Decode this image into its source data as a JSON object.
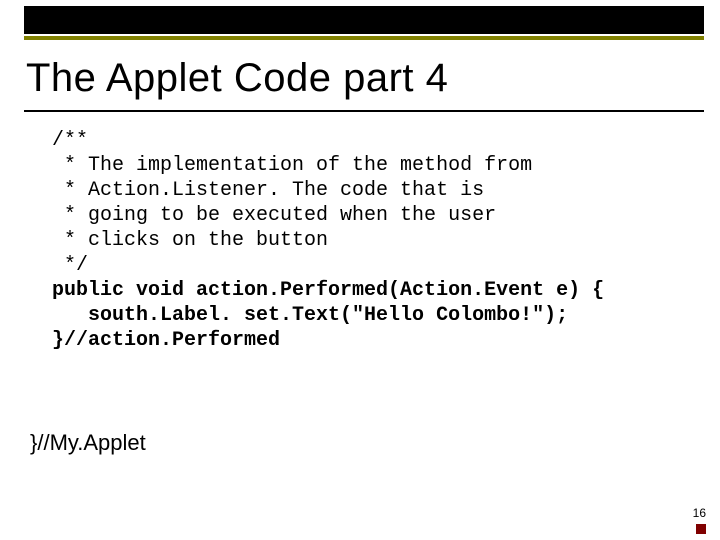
{
  "slide": {
    "title": "The Applet Code part 4",
    "page_number": "16"
  },
  "code": {
    "c1": "/**",
    "c2": " * The implementation of the method from",
    "c3": " * Action.Listener. The code that is",
    "c4": " * going to be executed when the user",
    "c5": " * clicks on the button",
    "c6": " */",
    "sig": "public void action.Performed(Action.Event e) {",
    "body": "   south.Label. set.Text(\"Hello Colombo!\");",
    "end": "}//action.Performed"
  },
  "closing": "}//My.Applet"
}
